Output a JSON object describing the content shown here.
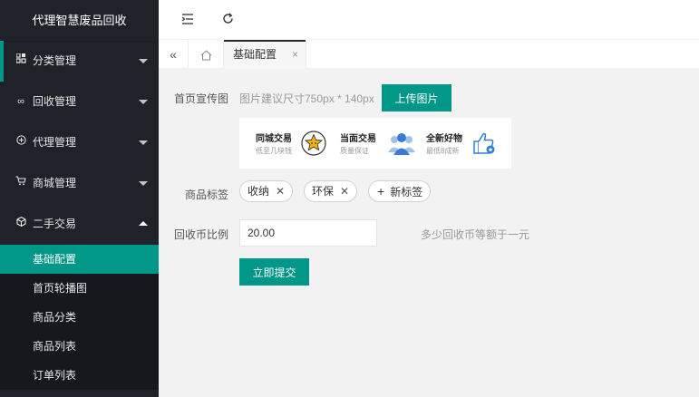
{
  "app": {
    "title": "代理智慧废品回收"
  },
  "sidebar": {
    "items": [
      {
        "label": "分类管理",
        "icon": "grid-icon"
      },
      {
        "label": "回收管理",
        "icon": "infinity-icon"
      },
      {
        "label": "代理管理",
        "icon": "plus-circle-icon"
      },
      {
        "label": "商城管理",
        "icon": "cart-icon"
      },
      {
        "label": "二手交易",
        "icon": "cube-icon"
      }
    ],
    "submenu": [
      {
        "label": "基础配置",
        "active": true
      },
      {
        "label": "首页轮播图"
      },
      {
        "label": "商品分类"
      },
      {
        "label": "商品列表"
      },
      {
        "label": "订单列表"
      }
    ]
  },
  "header": {
    "collapse_icon": "indent-icon",
    "refresh_icon": "refresh-icon"
  },
  "tabs": {
    "active_label": "基础配置",
    "close": "×"
  },
  "form": {
    "banner_label": "首页宣传图",
    "banner_hint": "图片建议尺寸750px * 140px",
    "upload_button": "上传图片",
    "banner": {
      "items": [
        {
          "title": "同城交易",
          "sub": "低至几块钱"
        },
        {
          "title": "当面交易",
          "sub": "质量保证"
        },
        {
          "title": "全新好物",
          "sub": "最低8成新"
        }
      ]
    },
    "tags_label": "商品标签",
    "tags": [
      "收纳",
      "环保"
    ],
    "new_tag": "新标签",
    "ratio_label": "回收币比例",
    "ratio_value": "20.00",
    "ratio_hint": "多少回收币等额于一元",
    "submit_button": "立即提交"
  },
  "colors": {
    "accent": "#009688",
    "sidebar_bg": "#20222a",
    "submenu_bg": "#17181d"
  }
}
